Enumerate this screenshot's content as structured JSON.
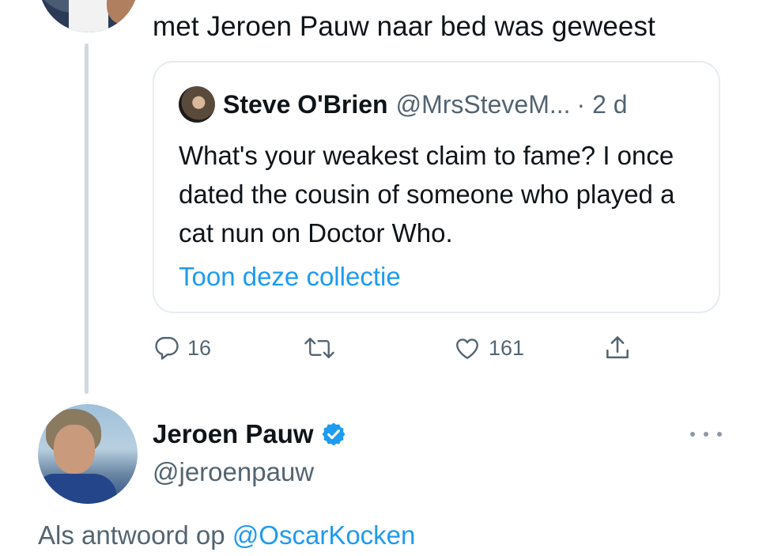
{
  "top_tweet": {
    "text": "met Jeroen Pauw naar bed was geweest"
  },
  "quoted_tweet": {
    "name": "Steve O'Brien",
    "handle": "@MrsSteveM...",
    "time": "· 2 d",
    "body": "What's your weakest claim to fame? I once dated the cousin of someone who played a cat nun on Doctor Who.",
    "link_text": "Toon deze collectie"
  },
  "actions": {
    "replies": "16",
    "likes": "161"
  },
  "reply_tweet": {
    "name": "Jeroen Pauw",
    "handle": "@jeroenpauw",
    "reply_prefix": "Als antwoord op",
    "reply_mention": "@OscarKocken"
  },
  "colors": {
    "link": "#1d9bf0",
    "secondary_text": "#536471",
    "border": "#e6ecf0",
    "thread_line": "#cfd9de",
    "verified": "#1d9bf0"
  },
  "icons": {
    "reply": "speech-bubble-icon",
    "retweet": "retweet-icon",
    "like": "heart-icon",
    "share": "share-icon",
    "verified": "verified-badge-icon",
    "more": "more-dots-icon"
  }
}
